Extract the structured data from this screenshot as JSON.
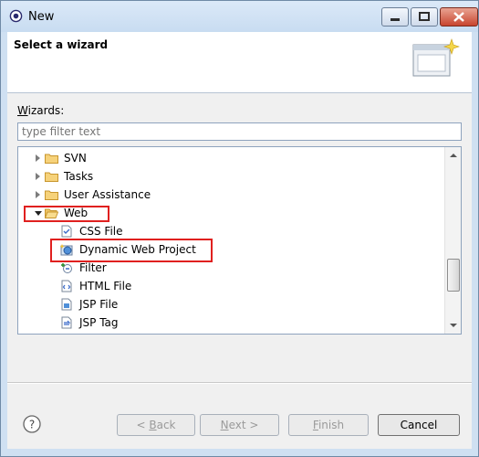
{
  "window": {
    "title": "New",
    "controls": {
      "minimize": "minimize",
      "maximize": "maximize",
      "close": "close"
    }
  },
  "header": {
    "title": "Select a wizard"
  },
  "wizards": {
    "label_prefix": "W",
    "label_rest": "izards:",
    "filter_placeholder": "type filter text",
    "tree": [
      {
        "label": "SVN",
        "kind": "folder",
        "expanded": false
      },
      {
        "label": "Tasks",
        "kind": "folder",
        "expanded": false
      },
      {
        "label": "User Assistance",
        "kind": "folder",
        "expanded": false
      },
      {
        "label": "Web",
        "kind": "folder",
        "expanded": true,
        "highlighted": true
      },
      {
        "label": "CSS File",
        "kind": "file",
        "icon": "css-file-icon"
      },
      {
        "label": "Dynamic Web Project",
        "kind": "file",
        "icon": "web-project-icon",
        "selected": true,
        "highlighted": true
      },
      {
        "label": "Filter",
        "kind": "file",
        "icon": "filter-icon"
      },
      {
        "label": "HTML File",
        "kind": "file",
        "icon": "html-file-icon"
      },
      {
        "label": "JSP File",
        "kind": "file",
        "icon": "jsp-file-icon"
      },
      {
        "label": "JSP Tag",
        "kind": "file",
        "icon": "jsp-tag-icon"
      }
    ]
  },
  "buttons": {
    "back": {
      "prefix": "< ",
      "mnemonic": "B",
      "rest": "ack"
    },
    "next": {
      "mnemonic": "N",
      "rest": "ext >"
    },
    "finish": {
      "mnemonic": "F",
      "rest": "inish"
    },
    "cancel": "Cancel"
  },
  "colors": {
    "highlight_border": "#e0201f",
    "folder": "#e8b84a",
    "disabled_text": "#9a9a9a"
  }
}
